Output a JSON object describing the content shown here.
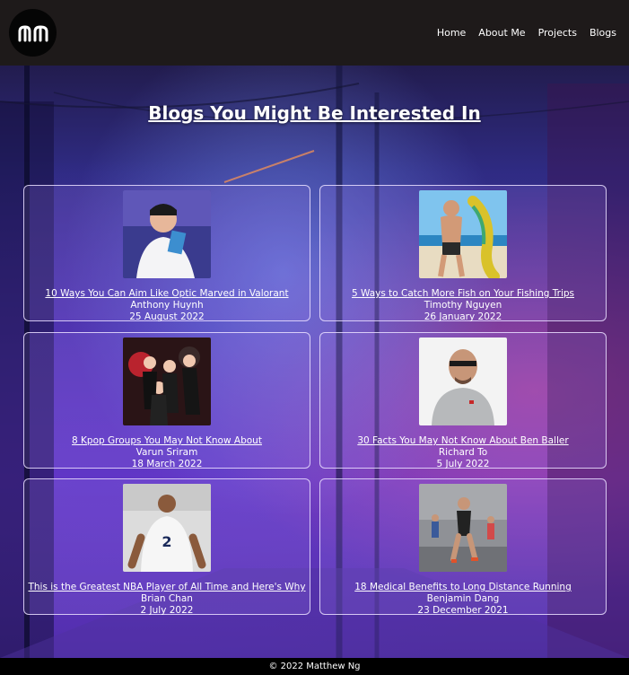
{
  "nav": {
    "logo_text": "mn",
    "links": [
      "Home",
      "About Me",
      "Projects",
      "Blogs"
    ]
  },
  "main": {
    "title": "Blogs You Might Be Interested In",
    "blogs": [
      {
        "title": "10 Ways You Can Aim Like Optic Marved in Valorant",
        "author": "Anthony Huynh",
        "date": "25 August 2022",
        "thumb": "gamer-photo"
      },
      {
        "title": "5 Ways to Catch More Fish on Your Fishing Trips",
        "author": "Timothy Nguyen",
        "date": "26 January 2022",
        "thumb": "fishing-photo"
      },
      {
        "title": "8 Kpop Groups You May Not Know About",
        "author": "Varun Sriram",
        "date": "18 March 2022",
        "thumb": "kpop-photo"
      },
      {
        "title": "30 Facts You May Not Know About Ben Baller",
        "author": "Richard To",
        "date": "5 July 2022",
        "thumb": "portrait-photo"
      },
      {
        "title": "This is the Greatest NBA Player of All Time and Here's Why",
        "author": "Brian Chan",
        "date": "2 July 2022",
        "thumb": "basketball-photo"
      },
      {
        "title": "18 Medical Benefits to Long Distance Running",
        "author": "Benjamin Dang",
        "date": "23 December 2021",
        "thumb": "running-photo"
      }
    ]
  },
  "footer": {
    "text": "© 2022 Matthew Ng"
  }
}
